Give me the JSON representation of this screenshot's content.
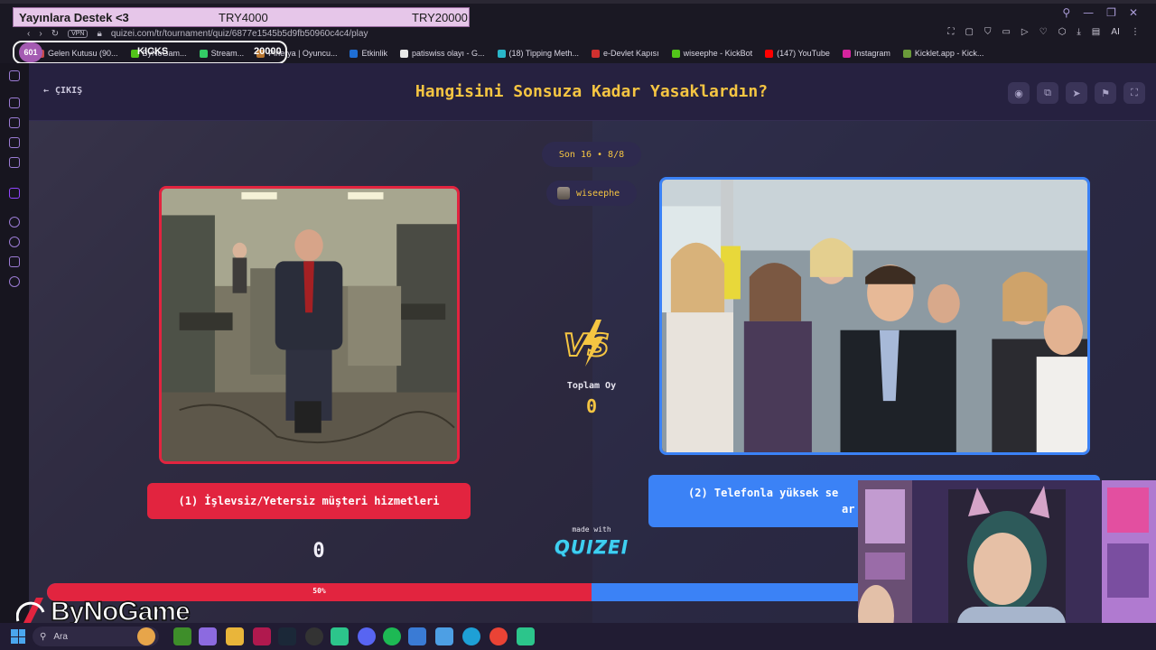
{
  "browser": {
    "donation": {
      "title": "Yayınlara Destek <3",
      "amount1": "TRY4000",
      "amount2": "TRY20000"
    },
    "url": "quizei.com/tr/tournament/quiz/6877e1545b5d9fb50960c4c4/play",
    "vpn_label": "VPN",
    "bookmarks": [
      {
        "label": "Gelen Kutusu (90...",
        "color": "#c84a4a"
      },
      {
        "label": "ByNoGam...",
        "color": "#52c41a"
      },
      {
        "label": "Stream...",
        "color": "#33cc66"
      },
      {
        "label": "Pinerya | Oyuncu...",
        "color": "#b8762f"
      },
      {
        "label": "Etkinlik",
        "color": "#1f6ed4"
      },
      {
        "label": "patiswiss olayı - G...",
        "color": "#e8e8e8"
      },
      {
        "label": "(18) Tipping Meth...",
        "color": "#29b6c9"
      },
      {
        "label": "e-Devlet Kapısı",
        "color": "#d0302f"
      },
      {
        "label": "wiseephe - KickBot",
        "color": "#52c41a"
      },
      {
        "label": "(147) YouTube",
        "color": "#ff0000"
      },
      {
        "label": "Instagram",
        "color": "#d6249f"
      },
      {
        "label": "Kicklet.app - Kick...",
        "color": "#6a9a3a"
      }
    ],
    "kicks_overlay": {
      "badge": "601",
      "label": "KICKS",
      "value": "20000"
    },
    "ai_label": "AI"
  },
  "quiz": {
    "exit_label": "ÇIKIŞ",
    "title": "Hangisini Sonsuza Kadar Yasaklardın?",
    "round": "Son 16 • 8/8",
    "user": "wiseephe",
    "total_votes_label": "Toplam Oy",
    "total_votes": "0",
    "option_left": "(1) İşlevsiz/Yetersiz müşteri hizmetleri",
    "option_right_line1": "(2) Telefonla yüksek se",
    "option_right_line2": "ar",
    "left_votes": "0",
    "made_with": "made with",
    "brand": "QUIZEI",
    "progress_label": "50%",
    "progress_fraction": 0.5,
    "colors": {
      "left": "#e2243f",
      "right": "#3b82f6",
      "accent": "#f5c542"
    }
  },
  "watermark": {
    "text": "ByNoGame"
  },
  "taskbar": {
    "search_placeholder": "Ara"
  }
}
